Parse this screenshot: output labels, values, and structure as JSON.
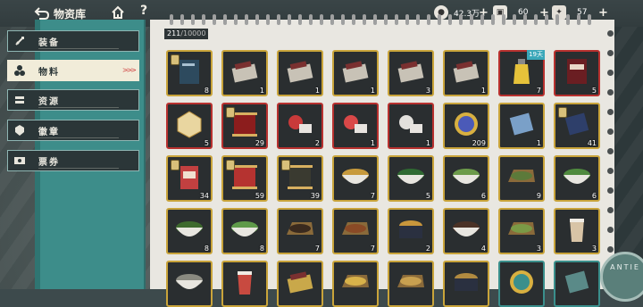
{
  "header": {
    "title": "物资库",
    "help": "?"
  },
  "resources": [
    {
      "icon": "coin-icon",
      "value": "42.3万",
      "plus": "+"
    },
    {
      "icon": "ticket-icon",
      "value": "60",
      "plus": "+"
    },
    {
      "icon": "gem-card-icon",
      "value": "57",
      "plus": "+"
    }
  ],
  "sidebar": {
    "tabs": [
      {
        "label": "装备",
        "icon": "equipment-icon",
        "active": false
      },
      {
        "label": "物料",
        "icon": "materials-icon",
        "active": true,
        "arrows": ">>>"
      },
      {
        "label": "资源",
        "icon": "resources-icon",
        "active": false
      },
      {
        "label": "徽章",
        "icon": "badge-icon",
        "active": false
      },
      {
        "label": "票券",
        "icon": "ticket-tab-icon",
        "active": false
      }
    ]
  },
  "storage": {
    "current": "211",
    "max": "/10000"
  },
  "stamp_text": "ANTIE",
  "items": [
    {
      "qty": "8",
      "frame": "gold",
      "kind": "manual",
      "color": "#2d4a5e",
      "tag": true
    },
    {
      "qty": "1",
      "frame": "gold",
      "kind": "box",
      "color": "#c8c2b6"
    },
    {
      "qty": "1",
      "frame": "gold",
      "kind": "box",
      "color": "#c8c2b6"
    },
    {
      "qty": "1",
      "frame": "gold",
      "kind": "box",
      "color": "#c8c2b6"
    },
    {
      "qty": "3",
      "frame": "gold",
      "kind": "box",
      "color": "#c8c2b6"
    },
    {
      "qty": "1",
      "frame": "gold",
      "kind": "box",
      "color": "#c8c2b6"
    },
    {
      "qty": "7",
      "frame": "red",
      "kind": "bottle",
      "color": "#e6c23a",
      "expire": "19天"
    },
    {
      "qty": "5",
      "frame": "red",
      "kind": "book",
      "color": "#6a1e22"
    },
    {
      "qty": "5",
      "frame": "red",
      "kind": "gem",
      "color": "#e9d6a0"
    },
    {
      "qty": "29",
      "frame": "red",
      "kind": "scroll",
      "color": "#8c1d1d",
      "tag": true
    },
    {
      "qty": "2",
      "frame": "red",
      "kind": "parts",
      "color": "#c83a3a"
    },
    {
      "qty": "1",
      "frame": "red",
      "kind": "parts",
      "color": "#d94848"
    },
    {
      "qty": "1",
      "frame": "red",
      "kind": "parts",
      "color": "#e2e0dc"
    },
    {
      "qty": "209",
      "frame": "gold",
      "kind": "orb",
      "color": "#4b5ab8"
    },
    {
      "qty": "1",
      "frame": "gold",
      "kind": "card",
      "color": "#7aa0c8"
    },
    {
      "qty": "41",
      "frame": "gold",
      "kind": "card",
      "color": "#2e3f6a",
      "tag": true
    },
    {
      "qty": "34",
      "frame": "gold",
      "kind": "pack",
      "color": "#c24040",
      "tag": true
    },
    {
      "qty": "59",
      "frame": "gold",
      "kind": "scroll",
      "color": "#b53330",
      "tag": true
    },
    {
      "qty": "39",
      "frame": "gold",
      "kind": "scroll",
      "color": "#3a3a30",
      "tag": true
    },
    {
      "qty": "7",
      "frame": "gold",
      "kind": "bowl",
      "color": "#c79a3c"
    },
    {
      "qty": "5",
      "frame": "gold",
      "kind": "bowl",
      "color": "#2f6a32"
    },
    {
      "qty": "6",
      "frame": "gold",
      "kind": "bowl",
      "color": "#6c9b4a"
    },
    {
      "qty": "9",
      "frame": "gold",
      "kind": "tray",
      "color": "#5c7a3a"
    },
    {
      "qty": "6",
      "frame": "gold",
      "kind": "bowl",
      "color": "#4f8a3e"
    },
    {
      "qty": "8",
      "frame": "gold",
      "kind": "bowl",
      "color": "#3e6a2e"
    },
    {
      "qty": "8",
      "frame": "gold",
      "kind": "bowl",
      "color": "#5f9a4a"
    },
    {
      "qty": "7",
      "frame": "gold",
      "kind": "tray",
      "color": "#3a2a1e"
    },
    {
      "qty": "7",
      "frame": "gold",
      "kind": "tray",
      "color": "#8a4a26"
    },
    {
      "qty": "2",
      "frame": "gold",
      "kind": "pot",
      "color": "#c8963c"
    },
    {
      "qty": "4",
      "frame": "gold",
      "kind": "bowl",
      "color": "#4a3226"
    },
    {
      "qty": "3",
      "frame": "gold",
      "kind": "tray",
      "color": "#7a9a46"
    },
    {
      "qty": "3",
      "frame": "gold",
      "kind": "cup",
      "color": "#d8c4a6"
    },
    {
      "qty": "",
      "frame": "gold",
      "kind": "bowl",
      "color": "#8a8a80"
    },
    {
      "qty": "",
      "frame": "gold",
      "kind": "cup",
      "color": "#c84a40"
    },
    {
      "qty": "",
      "frame": "gold",
      "kind": "box",
      "color": "#c9a84a"
    },
    {
      "qty": "",
      "frame": "gold",
      "kind": "tray",
      "color": "#d8b24a"
    },
    {
      "qty": "",
      "frame": "gold",
      "kind": "tray",
      "color": "#c8a050"
    },
    {
      "qty": "",
      "frame": "gold",
      "kind": "pot",
      "color": "#b08a40"
    },
    {
      "qty": "",
      "frame": "teal",
      "kind": "orb",
      "color": "#3a8f8c"
    },
    {
      "qty": "",
      "frame": "teal",
      "kind": "card",
      "color": "#5a8a88"
    }
  ]
}
